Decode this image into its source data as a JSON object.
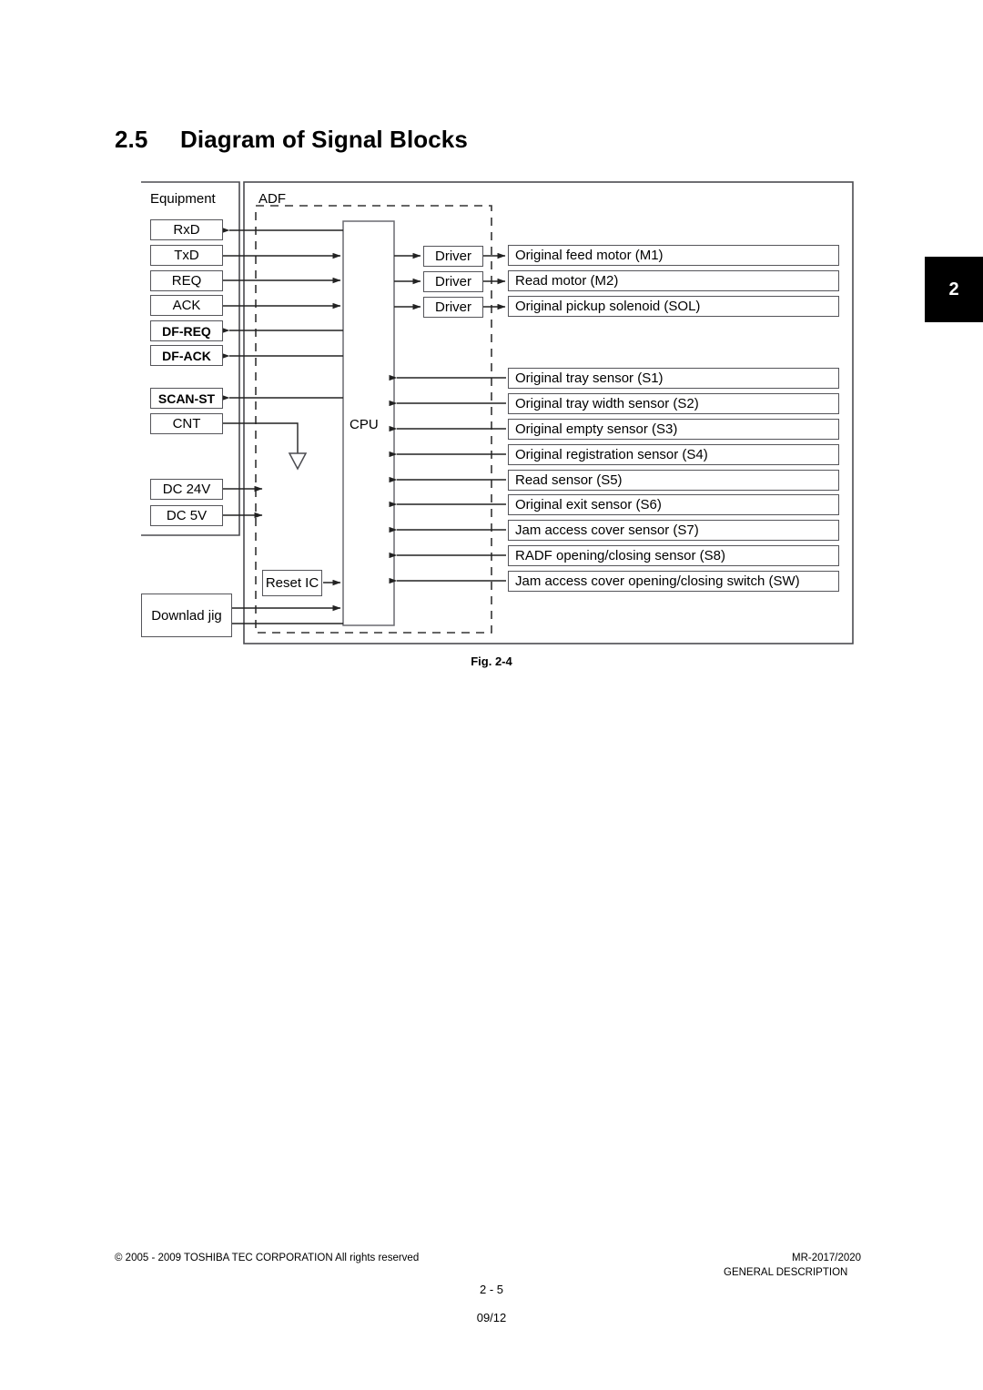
{
  "heading": {
    "number": "2.5",
    "title": "Diagram of Signal Blocks"
  },
  "page_tab": {
    "label": "2"
  },
  "diagram": {
    "group_labels": {
      "equipment": "Equipment",
      "adf": "ADF",
      "cpu": "CPU"
    },
    "signals": [
      {
        "label": "RxD",
        "dir": "to-equipment"
      },
      {
        "label": "TxD",
        "dir": "to-cpu"
      },
      {
        "label": "REQ",
        "dir": "to-cpu"
      },
      {
        "label": "ACK",
        "dir": "to-cpu"
      },
      {
        "label": "DF-REQ",
        "dir": "to-equipment"
      },
      {
        "label": "DF-ACK",
        "dir": "to-equipment"
      },
      {
        "label": "SCAN-ST",
        "dir": "to-equipment"
      },
      {
        "label": "CNT",
        "dir": "ground"
      }
    ],
    "power": [
      {
        "label": "DC 24V",
        "dir": "to-cpu"
      },
      {
        "label": "DC 5V",
        "dir": "to-cpu"
      }
    ],
    "download_jig": {
      "label": "Downlad jig"
    },
    "reset_ic": {
      "label": "Reset IC"
    },
    "drivers": [
      {
        "label": "Driver"
      },
      {
        "label": "Driver"
      },
      {
        "label": "Driver"
      }
    ],
    "actuators": [
      "Original feed motor (M1)",
      "Read motor (M2)",
      "Original pickup solenoid (SOL)"
    ],
    "sensors": [
      "Original tray sensor (S1)",
      "Original tray width sensor (S2)",
      "Original empty sensor (S3)",
      "Original registration sensor (S4)",
      "Read sensor (S5)",
      "Original exit sensor (S6)",
      "Jam access cover sensor (S7)",
      "RADF opening/closing sensor (S8)",
      "Jam access cover opening/closing switch (SW)"
    ]
  },
  "caption": "Fig. 2-4",
  "footer": {
    "copyright": "© 2005 - 2009 TOSHIBA TEC CORPORATION All rights reserved",
    "model": "MR-2017/2020",
    "section": "GENERAL DESCRIPTION",
    "page": "2 - 5",
    "date": "09/12"
  }
}
